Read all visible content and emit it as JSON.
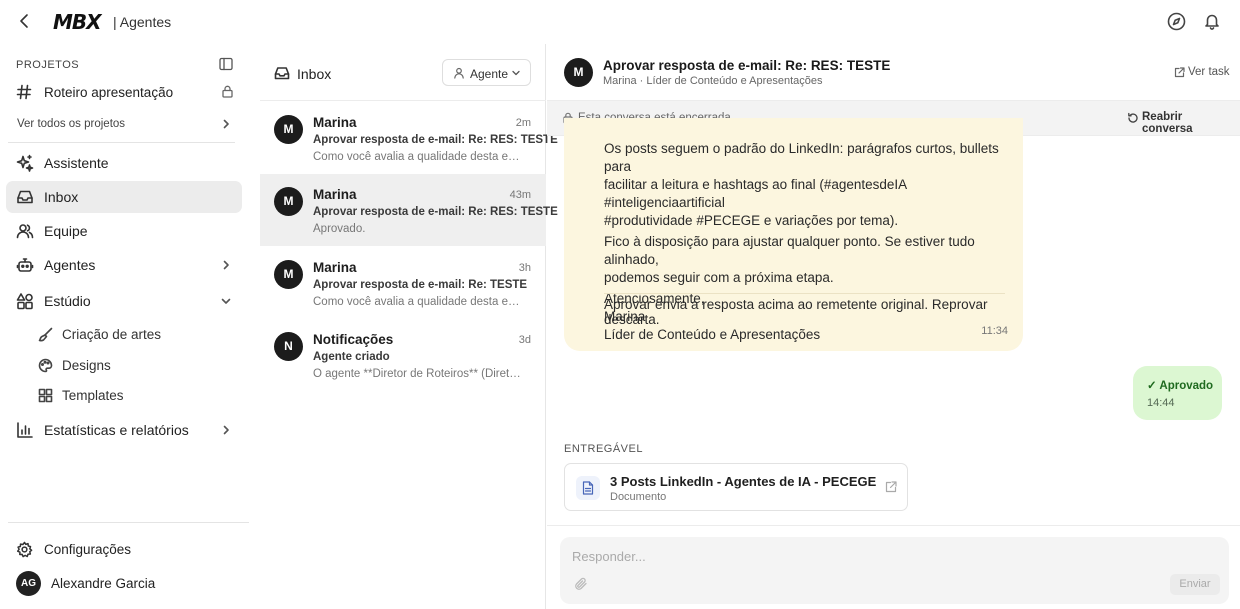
{
  "topbar": {
    "logo": "MBX",
    "subtitle": "| Agentes"
  },
  "sidebar": {
    "section_label": "PROJETOS",
    "project": "Roteiro apresentação",
    "see_all": "Ver todos os projetos",
    "nav": [
      {
        "label": "Assistente",
        "icon": "sparkles-icon"
      },
      {
        "label": "Inbox",
        "icon": "inbox-icon",
        "active": true
      },
      {
        "label": "Equipe",
        "icon": "users-icon"
      },
      {
        "label": "Agentes",
        "icon": "bot-icon"
      },
      {
        "label": "Estúdio",
        "icon": "shapes-icon"
      },
      {
        "label": "Estatísticas e relatórios",
        "icon": "bar-chart-icon"
      }
    ],
    "studio_sub": [
      {
        "label": "Criação de artes",
        "icon": "brush-icon"
      },
      {
        "label": "Designs",
        "icon": "palette-icon"
      },
      {
        "label": "Templates",
        "icon": "grid-icon"
      }
    ],
    "settings": "Configurações",
    "user": {
      "initials": "AG",
      "name": "Alexandre Garcia"
    }
  },
  "inbox": {
    "title": "Inbox",
    "filter": "Agente",
    "conversations": [
      {
        "initial": "M",
        "name": "Marina",
        "time": "2m",
        "subject": "Aprovar resposta de e-mail: Re: RES: TESTE",
        "preview": "Como você avalia a qualidade desta entre..."
      },
      {
        "initial": "M",
        "name": "Marina",
        "time": "43m",
        "subject": "Aprovar resposta de e-mail: Re: RES: TESTE",
        "preview": "Aprovado.",
        "selected": true
      },
      {
        "initial": "M",
        "name": "Marina",
        "time": "3h",
        "subject": "Aprovar resposta de e-mail: Re: TESTE",
        "preview": "Como você avalia a qualidade desta entre..."
      },
      {
        "initial": "N",
        "name": "Notificações",
        "time": "3d",
        "subject": "Agente criado",
        "preview": "O agente **Diretor de Roteiros** (Diretor ..."
      }
    ]
  },
  "thread": {
    "avatar": "M",
    "title": "Aprovar resposta de e-mail: Re: RES: TESTE",
    "subtitle": "Marina · Líder de Conteúdo e Apresentações",
    "view_task": "Ver task",
    "closed_notice": "Esta conversa está encerrada.",
    "reopen": "Reabrir conversa",
    "message": {
      "lines": [
        "Os posts seguem o padrão do LinkedIn: parágrafos curtos, bullets para",
        "facilitar a leitura e hashtags ao final (#agentesdeIA #inteligenciaartificial",
        "#produtividade #PECEGE e variações por tema).",
        "Fico à disposição para ajustar qualquer ponto. Se estiver tudo alinhado,",
        "podemos seguir com a próxima etapa.",
        "Atenciosamente,",
        "Marina",
        "Líder de Conteúdo e Apresentações"
      ],
      "note": "Aprovar envia a resposta acima ao remetente original. Reprovar descarta.",
      "time": "11:34"
    },
    "reply": {
      "text": "✓ Aprovado",
      "time": "14:44"
    },
    "deliverable_label": "ENTREGÁVEL",
    "deliverable": {
      "title": "3 Posts LinkedIn - Agentes de IA - PECEGE",
      "type": "Documento"
    },
    "composer": {
      "placeholder": "Responder...",
      "send": "Enviar"
    }
  }
}
